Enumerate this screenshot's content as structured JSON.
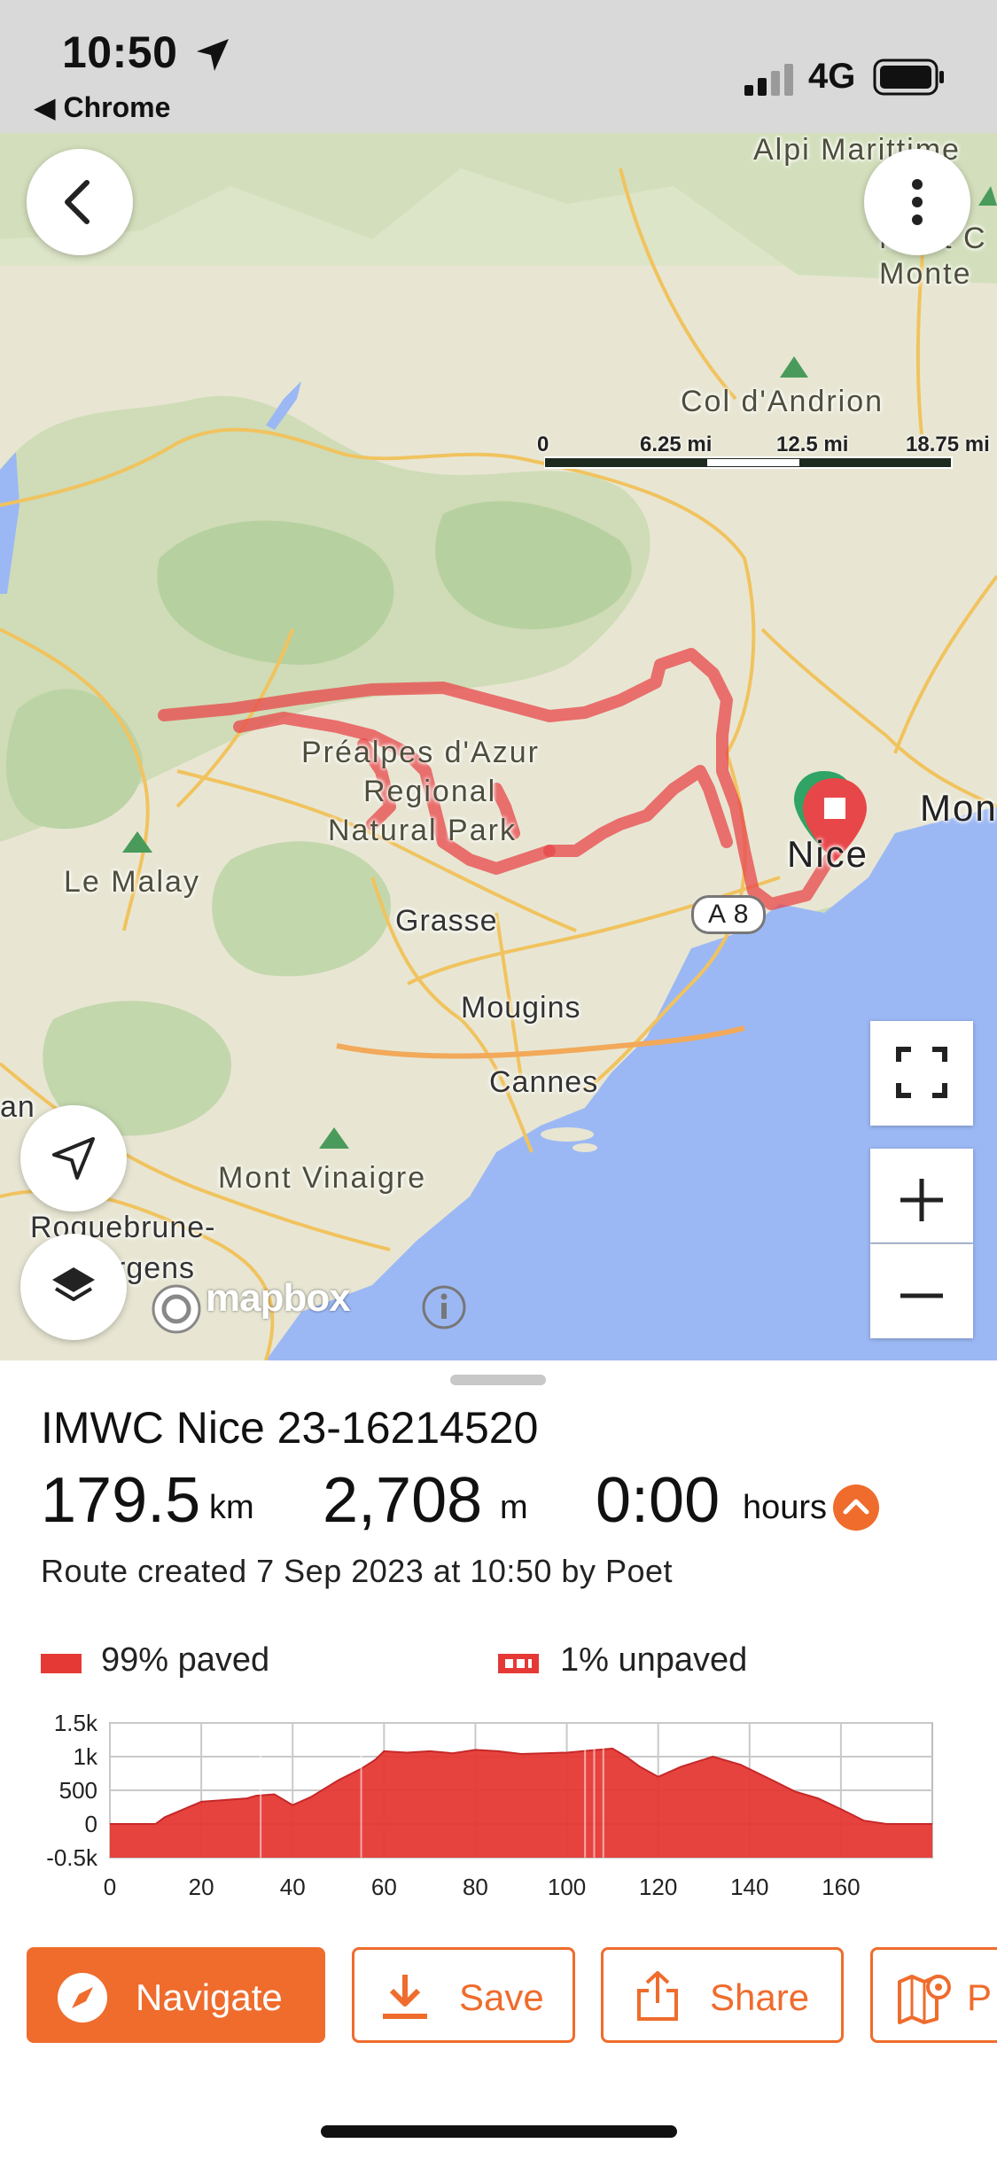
{
  "status_bar": {
    "time": "10:50",
    "back_app": "◀ Chrome",
    "network": "4G"
  },
  "map": {
    "scale": {
      "labels": [
        "0",
        "6.25 mi",
        "12.5 mi",
        "18.75 mi"
      ]
    },
    "labels": {
      "alpi": "Alpi Marittime",
      "mont_c": "Mont C",
      "monte": "Monte",
      "col_dandrion": "Col d'Andrion",
      "prealpes_1": "Préalpes d'Azur",
      "prealpes_2": "Regional",
      "prealpes_3": "Natural Park",
      "le_malay": "Le Malay",
      "grasse": "Grasse",
      "mougins": "Mougins",
      "cannes": "Cannes",
      "mont_vinaigre": "Mont Vinaigre",
      "roquebrune_1": "Roquebrune-",
      "roquebrune_2": "rgens",
      "an": "an",
      "nice": "Nice",
      "mon": "Mon",
      "road_a8": "A 8"
    },
    "attribution": "mapbox",
    "route_color": "#e8474a"
  },
  "route": {
    "name": "IMWC Nice 23-16214520",
    "distance_value": "179.5",
    "distance_unit": "km",
    "elevation_value": "2,708",
    "elevation_unit": "m",
    "duration_value": "0:00",
    "duration_unit": "hours",
    "created": "Route created 7 Sep 2023 at 10:50 by Poet"
  },
  "surface": {
    "paved": "99% paved",
    "unpaved": "1% unpaved"
  },
  "chart_data": {
    "type": "area",
    "y_tick_labels": [
      "1.5k",
      "1k",
      "500",
      "0",
      "-0.5k"
    ],
    "x_tick_labels": [
      "0",
      "20",
      "40",
      "60",
      "80",
      "100",
      "120",
      "140",
      "160"
    ],
    "xlim": [
      0,
      180
    ],
    "ylim": [
      -500,
      1500
    ],
    "grid": true,
    "color": "#e53935",
    "x": [
      0,
      10,
      12,
      20,
      30,
      32,
      36,
      40,
      44,
      50,
      55,
      58,
      60,
      65,
      70,
      75,
      80,
      85,
      90,
      95,
      100,
      105,
      110,
      113,
      116,
      120,
      125,
      132,
      138,
      145,
      150,
      155,
      160,
      165,
      170,
      180
    ],
    "y": [
      0,
      0,
      100,
      330,
      380,
      420,
      440,
      280,
      400,
      650,
      820,
      950,
      1080,
      1060,
      1080,
      1050,
      1100,
      1080,
      1040,
      1050,
      1060,
      1090,
      1120,
      1000,
      850,
      700,
      850,
      1000,
      880,
      650,
      480,
      380,
      220,
      50,
      0,
      0
    ],
    "markers_x": [
      33,
      55,
      104,
      106,
      108
    ]
  },
  "actions": {
    "navigate": "Navigate",
    "save": "Save",
    "share": "Share",
    "plan": "P"
  }
}
